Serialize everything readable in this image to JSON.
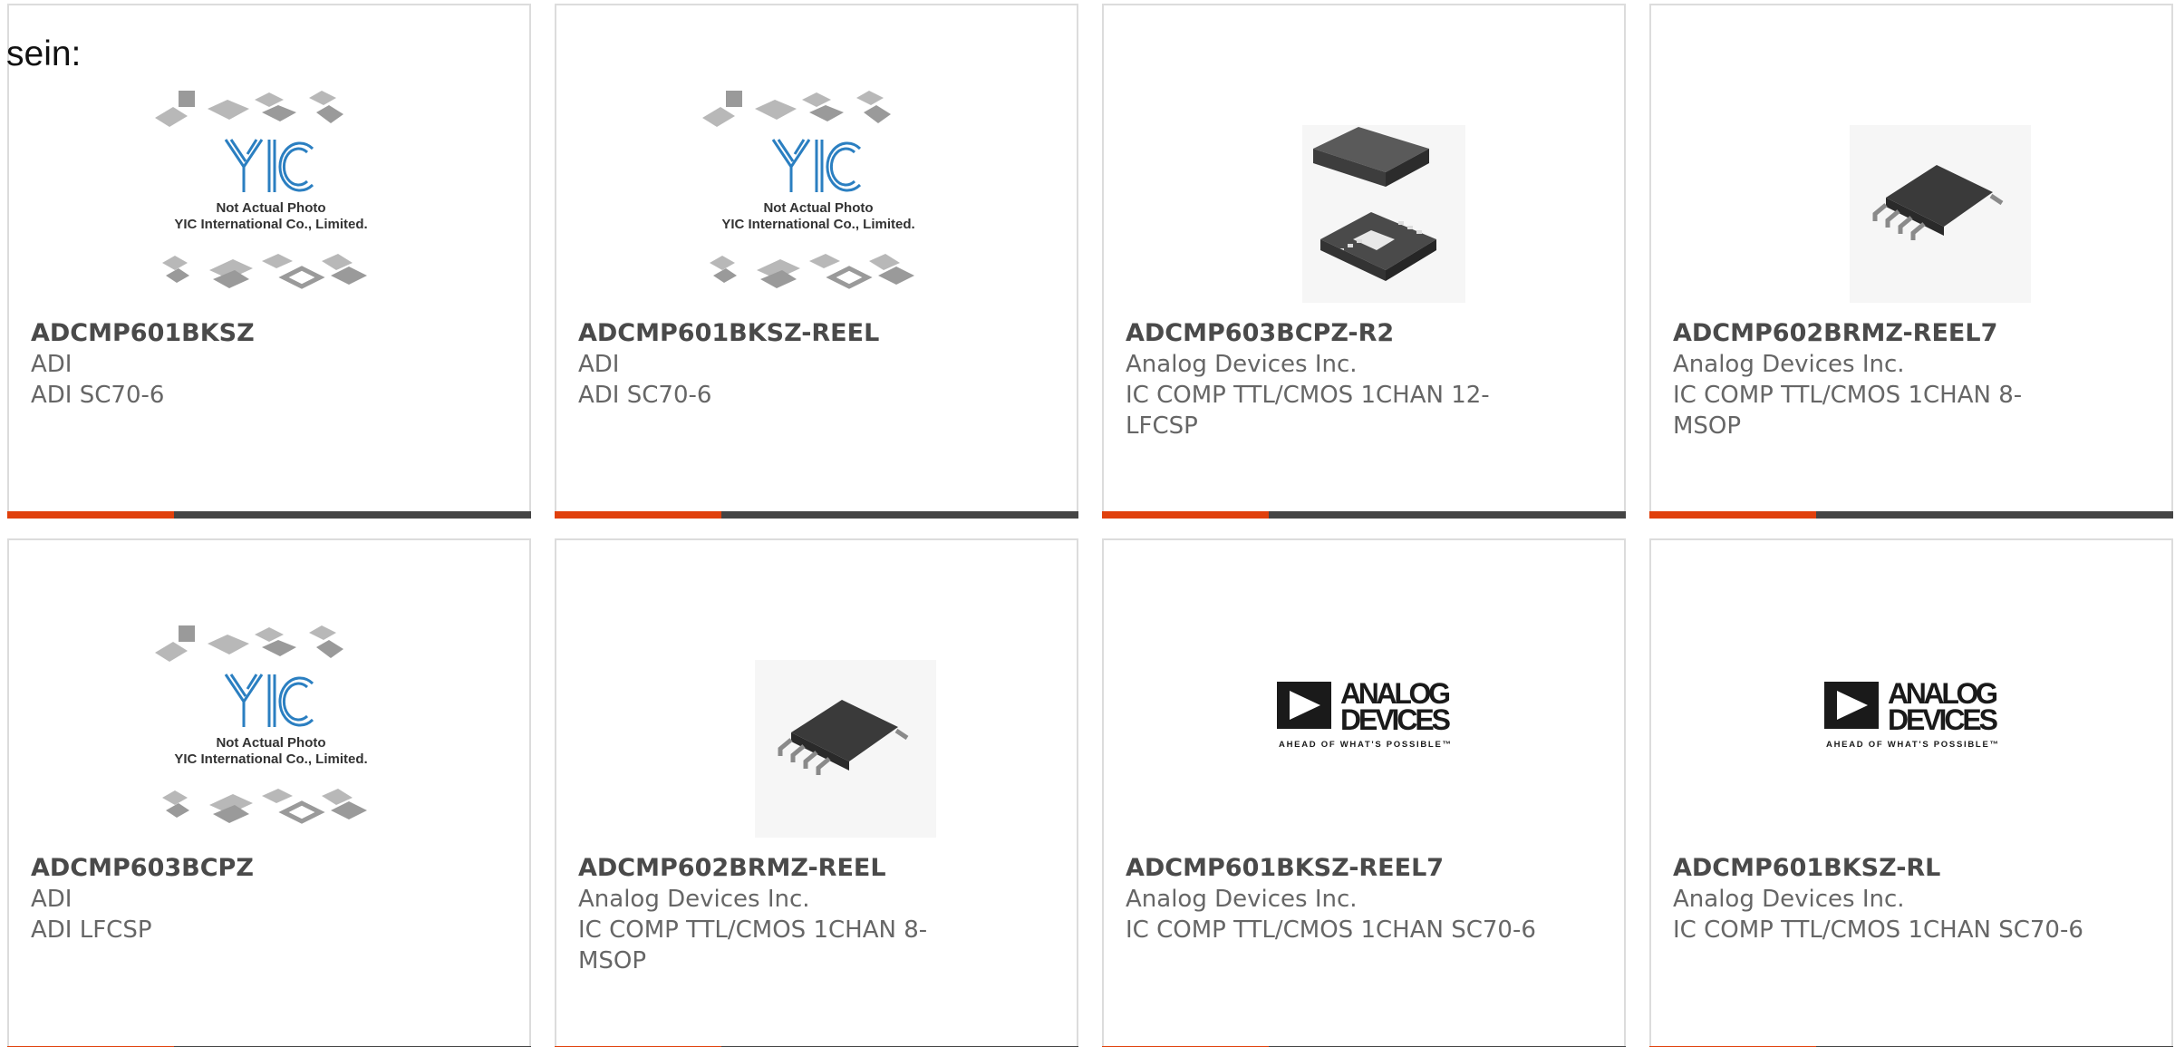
{
  "intro_text": "sein:",
  "colors": {
    "accent": "#e0400c",
    "bar": "#444444",
    "border": "#dcdcdc",
    "text": "#666666",
    "title": "#4a4a4a",
    "logo_blue": "#2b7fc1"
  },
  "placeholder_image": {
    "line1": "Not Actual Photo",
    "line2": "YIC International Co., Limited.",
    "logo": "YIC"
  },
  "analog_logo": {
    "line1": "ANALOG",
    "line2": "DEVICES",
    "tagline": "AHEAD OF WHAT'S POSSIBLE™"
  },
  "products": [
    {
      "part": "ADCMP601BKSZ",
      "maker": "ADI",
      "desc": "ADI SC70-6",
      "image": "yic-placeholder"
    },
    {
      "part": "ADCMP601BKSZ-REEL",
      "maker": "ADI",
      "desc": "ADI SC70-6",
      "image": "yic-placeholder"
    },
    {
      "part": "ADCMP603BCPZ-R2",
      "maker": "Analog Devices Inc.",
      "desc": "IC COMP TTL/CMOS 1CHAN 12-LFCSP",
      "image": "lfcsp-chip"
    },
    {
      "part": "ADCMP602BRMZ-REEL7",
      "maker": "Analog Devices Inc.",
      "desc": "IC COMP TTL/CMOS 1CHAN 8-MSOP",
      "image": "msop-chip"
    },
    {
      "part": "ADCMP603BCPZ",
      "maker": "ADI",
      "desc": "ADI LFCSP",
      "image": "yic-placeholder"
    },
    {
      "part": "ADCMP602BRMZ-REEL",
      "maker": "Analog Devices Inc.",
      "desc": "IC COMP TTL/CMOS 1CHAN 8-MSOP",
      "image": "msop-chip"
    },
    {
      "part": "ADCMP601BKSZ-REEL7",
      "maker": "Analog Devices Inc.",
      "desc": "IC COMP TTL/CMOS 1CHAN SC70-6",
      "image": "analog-devices-logo"
    },
    {
      "part": "ADCMP601BKSZ-RL",
      "maker": "Analog Devices Inc.",
      "desc": "IC COMP TTL/CMOS 1CHAN SC70-6",
      "image": "analog-devices-logo"
    }
  ]
}
